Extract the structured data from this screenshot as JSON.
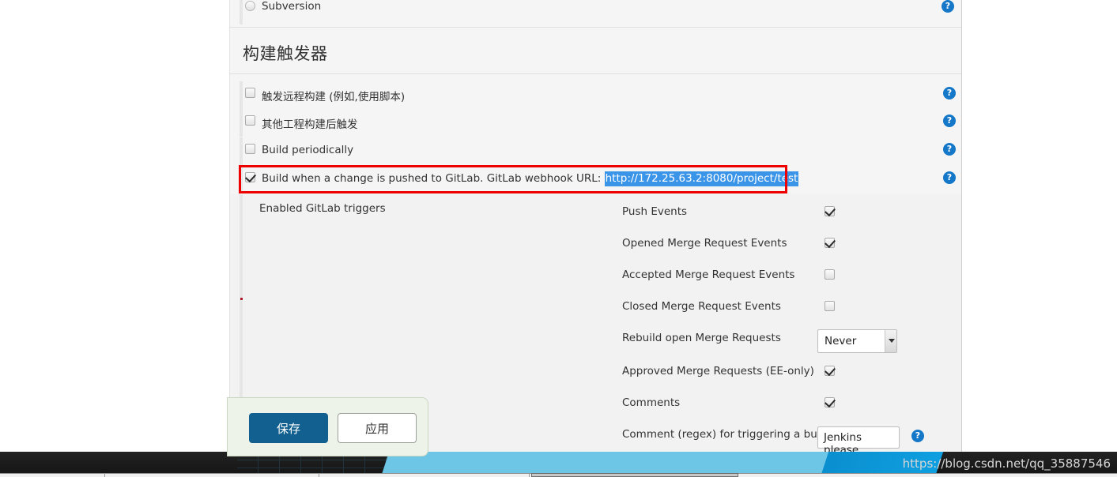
{
  "panel": {
    "scm": {
      "option_label": "Subversion",
      "radio_selected": false
    },
    "section_title": "构建触发器",
    "triggers": [
      {
        "label_main": "触发远程构建",
        "label_sub": " (例如,使用脚本)",
        "checked": false,
        "help": "?"
      },
      {
        "label_main": "其他工程构建后触发",
        "label_sub": "",
        "checked": false,
        "help": "?"
      },
      {
        "label_main": "Build periodically",
        "label_sub": "",
        "checked": false,
        "help": "?"
      }
    ],
    "gitlab_trigger": {
      "label": "Build when a change is pushed to GitLab. GitLab webhook URL:",
      "webhook_url": "http://172.25.63.2:8080/project/test",
      "checked": true,
      "help": "?",
      "highlight_color": "#ef0000",
      "selection_color": "#3a94e8"
    },
    "gitlab_section": {
      "title": "Enabled GitLab triggers",
      "rows": [
        {
          "label": "Push Events",
          "type": "checkbox",
          "checked": true
        },
        {
          "label": "Opened Merge Request Events",
          "type": "checkbox",
          "checked": true
        },
        {
          "label": "Accepted Merge Request Events",
          "type": "checkbox",
          "checked": false
        },
        {
          "label": "Closed Merge Request Events",
          "type": "checkbox",
          "checked": false
        },
        {
          "label": "Rebuild open Merge Requests",
          "type": "select",
          "value": "Never"
        },
        {
          "label": "Approved Merge Requests (EE-only)",
          "type": "checkbox",
          "checked": true
        },
        {
          "label": "Comments",
          "type": "checkbox",
          "checked": true
        },
        {
          "label": "Comment (regex) for triggering a build",
          "type": "text",
          "value": "Jenkins please",
          "help": "?"
        }
      ]
    },
    "actions": {
      "save_label": "保存",
      "apply_label": "应用",
      "save_color": "#12608f"
    }
  },
  "taskbar": {
    "watermark": "https://blog.csdn.net/qq_35887546"
  }
}
